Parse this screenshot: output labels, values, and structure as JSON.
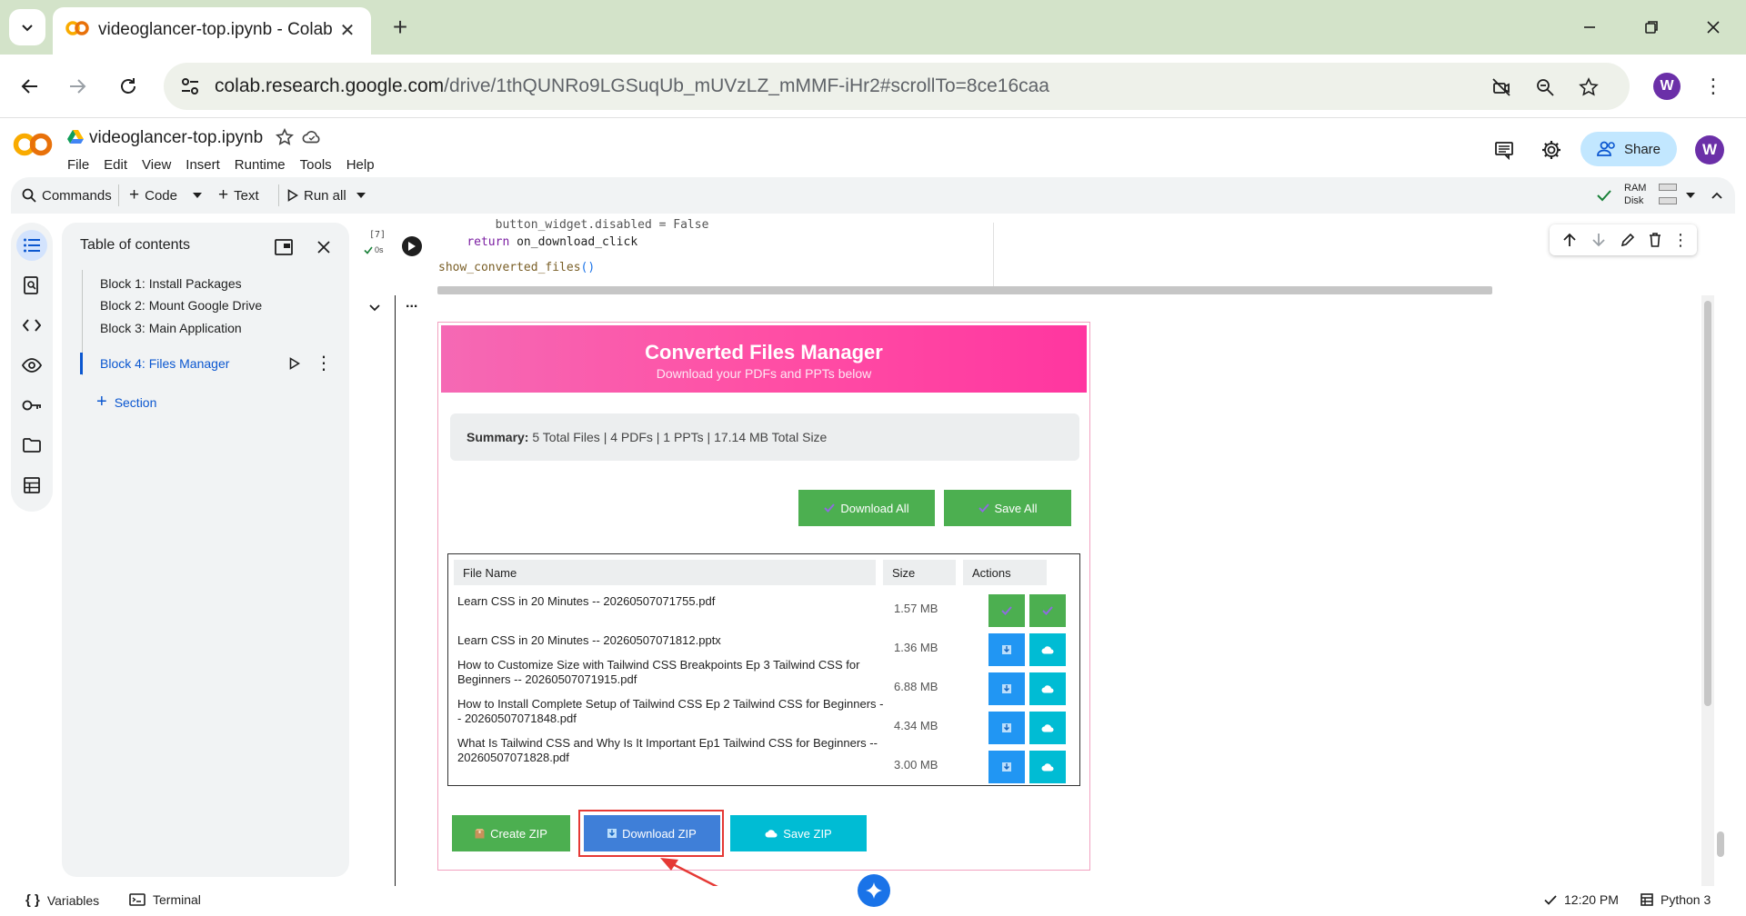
{
  "browser": {
    "tab_title": "videoglancer-top.ipynb - Colab",
    "url_host": "colab.research.google.com",
    "url_path": "/drive/1thQUNRo9LGSuqUb_mUVzLZ_mMMF-iHr2#scrollTo=8ce16caa",
    "profile_initial": "W"
  },
  "colab": {
    "notebook_title": "videoglancer-top.ipynb",
    "menu": [
      "File",
      "Edit",
      "View",
      "Insert",
      "Runtime",
      "Tools",
      "Help"
    ],
    "share_label": "Share",
    "profile_initial": "W"
  },
  "toolbar": {
    "commands": "Commands",
    "code": "Code",
    "text": "Text",
    "run_all": "Run all",
    "ram": "RAM",
    "disk": "Disk"
  },
  "toc": {
    "title": "Table of contents",
    "items": [
      "Block 1: Install Packages",
      "Block 2: Mount Google Drive",
      "Block 3: Main Application",
      "Block 4: Files Manager"
    ],
    "add_section": "Section"
  },
  "cell": {
    "exec_count": "[7]",
    "exec_time": "0s",
    "line1": "        button_widget.disabled = False",
    "line2_kw": "return",
    "line2_rest": " on_download_click",
    "line3_fn": "show_converted_files",
    "line3_paren": "()",
    "output_more": "..."
  },
  "files_manager": {
    "title": "Converted Files Manager",
    "subtitle": "Download your PDFs and PPTs below",
    "summary_label": "Summary:",
    "summary_text": " 5 Total Files | 4 PDFs | 1 PPTs | 17.14 MB Total Size",
    "download_all": "Download All",
    "save_all": "Save All",
    "headers": {
      "name": "File Name",
      "size": "Size",
      "actions": "Actions"
    },
    "rows": [
      {
        "name": "Learn CSS in 20 Minutes -- 20260507071755.pdf",
        "size": "1.57 MB"
      },
      {
        "name": "Learn CSS in 20 Minutes -- 20260507071812.pptx",
        "size": "1.36 MB"
      },
      {
        "name": "How to Customize Size with Tailwind CSS Breakpoints Ep 3 Tailwind CSS for Beginners -- 20260507071915.pdf",
        "size": "6.88 MB"
      },
      {
        "name": "How to Install Complete Setup of Tailwind CSS Ep 2 Tailwind CSS for Beginners -- 20260507071848.pdf",
        "size": "4.34 MB"
      },
      {
        "name": "What Is Tailwind CSS and Why Is It Important Ep1 Tailwind CSS for Beginners -- 20260507071828.pdf",
        "size": "3.00 MB"
      }
    ],
    "create_zip": "Create ZIP",
    "download_zip": "Download ZIP",
    "save_zip": "Save ZIP"
  },
  "status": {
    "variables": "Variables",
    "terminal": "Terminal",
    "time": "12:20 PM",
    "runtime": "Python 3"
  },
  "colors": {
    "accent_blue": "#0b57d0",
    "header_pink": "#ff4fa5",
    "green": "#4caf50",
    "blue": "#2196f3",
    "cyan": "#00bcd4",
    "annotation_red": "#e53935"
  }
}
